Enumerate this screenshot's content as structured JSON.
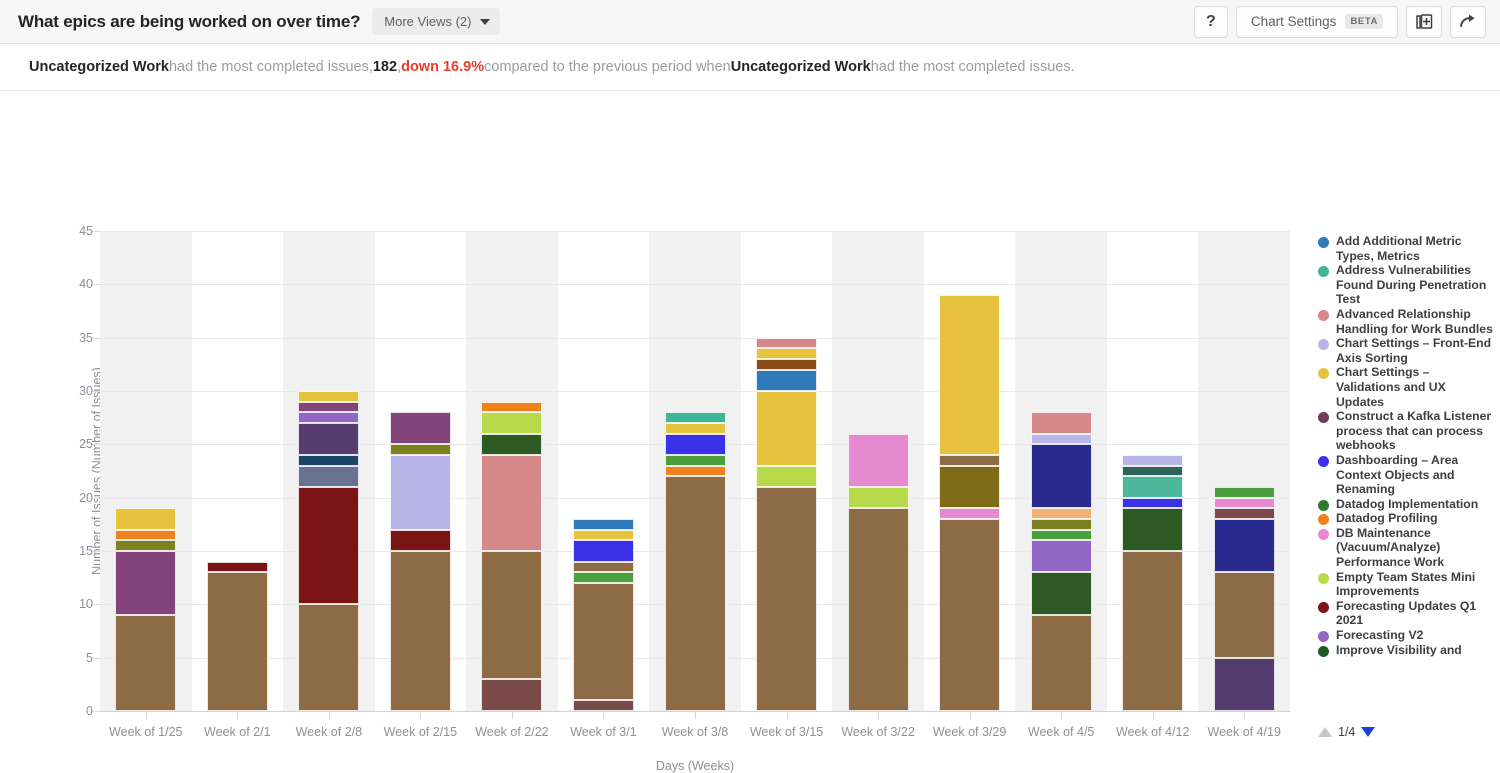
{
  "header": {
    "title": "What epics are being worked on over time?",
    "more_views_label": "More Views (2)",
    "help_label": "?",
    "chart_settings_label": "Chart Settings",
    "beta_label": "BETA",
    "duplicate_icon": "add-to-collection-icon",
    "share_icon": "share-arrow-icon"
  },
  "insight": {
    "entity": "Uncategorized Work",
    "text1": " had the most completed issues, ",
    "count": "182",
    "comma": ", ",
    "delta": "down 16.9%",
    "text2": " compared to the previous period when ",
    "entity2": "Uncategorized Work",
    "text3": " had the most completed issues."
  },
  "legend": {
    "page": "1/4",
    "items": [
      {
        "label": "Add Additional Metric Types, Metrics",
        "color": "#2f7ab8"
      },
      {
        "label": "Address Vulnerabilities Found During Penetration Test",
        "color": "#3fb597"
      },
      {
        "label": "Advanced Relationship Handling for Work Bundles",
        "color": "#d4888a"
      },
      {
        "label": "Chart Settings – Front-End Axis Sorting",
        "color": "#b9b5e8"
      },
      {
        "label": "Chart Settings – Validations and UX Updates",
        "color": "#e6c23f"
      },
      {
        "label": "Construct a Kafka Listener process that can process webhooks",
        "color": "#713a5e"
      },
      {
        "label": "Dashboarding – Area Context Objects and Renaming",
        "color": "#3b32e8"
      },
      {
        "label": "Datadog Implementation",
        "color": "#2d7a2a"
      },
      {
        "label": "Datadog Profiling",
        "color": "#f0821e"
      },
      {
        "label": "DB Maintenance (Vacuum/Analyze) Performance Work",
        "color": "#e589d0"
      },
      {
        "label": "Empty Team States Mini Improvements",
        "color": "#b7d94a"
      },
      {
        "label": "Forecasting Updates Q1 2021",
        "color": "#7b1414"
      },
      {
        "label": "Forecasting V2",
        "color": "#9166c4"
      },
      {
        "label": "Improve Visibility and",
        "color": "#1f5a22"
      }
    ]
  },
  "chart_data": {
    "type": "bar",
    "stacked": true,
    "title": "What epics are being worked on over time?",
    "xlabel": "Days (Weeks)",
    "ylabel": "Number of Issues (Number of Issues)",
    "ylim": [
      0,
      45
    ],
    "yticks": [
      0,
      5,
      10,
      15,
      20,
      25,
      30,
      35,
      40,
      45
    ],
    "grid": true,
    "legend_position": "right",
    "categories": [
      "Week of 1/25",
      "Week of 2/1",
      "Week of 2/8",
      "Week of 2/15",
      "Week of 2/22",
      "Week of 3/1",
      "Week of 3/8",
      "Week of 3/15",
      "Week of 3/22",
      "Week of 3/29",
      "Week of 4/5",
      "Week of 4/12",
      "Week of 4/19"
    ],
    "totals": [
      19,
      14,
      30,
      28,
      29,
      18,
      28,
      35,
      26,
      39,
      28,
      24,
      21
    ],
    "bars": [
      {
        "category": "Week of 1/25",
        "total": 19,
        "segments": [
          {
            "value": 9,
            "color": "#8d6b44"
          },
          {
            "value": 6,
            "color": "#82447a"
          },
          {
            "value": 1,
            "color": "#7d8021"
          },
          {
            "value": 1,
            "color": "#f0821e"
          },
          {
            "value": 2,
            "color": "#e6c23f"
          }
        ]
      },
      {
        "category": "Week of 2/1",
        "total": 14,
        "segments": [
          {
            "value": 13,
            "color": "#8d6b44"
          },
          {
            "value": 1,
            "color": "#7b1414"
          }
        ]
      },
      {
        "category": "Week of 2/8",
        "total": 30,
        "segments": [
          {
            "value": 10,
            "color": "#8d6b44"
          },
          {
            "value": 11,
            "color": "#7b1414"
          },
          {
            "value": 2,
            "color": "#6b7191"
          },
          {
            "value": 1,
            "color": "#1c4467"
          },
          {
            "value": 3,
            "color": "#553b6e"
          },
          {
            "value": 1,
            "color": "#9166c4"
          },
          {
            "value": 1,
            "color": "#82447a"
          },
          {
            "value": 1,
            "color": "#e6c23f"
          }
        ]
      },
      {
        "category": "Week of 2/15",
        "total": 28,
        "segments": [
          {
            "value": 15,
            "color": "#8d6b44"
          },
          {
            "value": 2,
            "color": "#7b1414"
          },
          {
            "value": 7,
            "color": "#b9b5e8"
          },
          {
            "value": 1,
            "color": "#7d8021"
          },
          {
            "value": 3,
            "color": "#82447a"
          }
        ]
      },
      {
        "category": "Week of 2/22",
        "total": 29,
        "segments": [
          {
            "value": 3,
            "color": "#7a4a4a"
          },
          {
            "value": 12,
            "color": "#8d6b44"
          },
          {
            "value": 9,
            "color": "#d4888a"
          },
          {
            "value": 2,
            "color": "#2d5a22"
          },
          {
            "value": 2,
            "color": "#b7d94a"
          },
          {
            "value": 1,
            "color": "#f0821e"
          }
        ]
      },
      {
        "category": "Week of 3/1",
        "total": 18,
        "segments": [
          {
            "value": 1,
            "color": "#7a4a4a"
          },
          {
            "value": 11,
            "color": "#8d6b44"
          },
          {
            "value": 1,
            "color": "#4a9e3c"
          },
          {
            "value": 1,
            "color": "#8d6b44"
          },
          {
            "value": 2,
            "color": "#3b32e8"
          },
          {
            "value": 1,
            "color": "#e6c23f"
          },
          {
            "value": 1,
            "color": "#2f7ab8"
          }
        ]
      },
      {
        "category": "Week of 3/8",
        "total": 28,
        "segments": [
          {
            "value": 22,
            "color": "#8d6b44"
          },
          {
            "value": 1,
            "color": "#f0821e"
          },
          {
            "value": 1,
            "color": "#4a9e3c"
          },
          {
            "value": 2,
            "color": "#3b32e8"
          },
          {
            "value": 1,
            "color": "#e6c23f"
          },
          {
            "value": 1,
            "color": "#3fb597"
          }
        ]
      },
      {
        "category": "Week of 3/15",
        "total": 35,
        "segments": [
          {
            "value": 21,
            "color": "#8d6b44"
          },
          {
            "value": 2,
            "color": "#b7d94a"
          },
          {
            "value": 7,
            "color": "#e6c23f"
          },
          {
            "value": 2,
            "color": "#2f7ab8"
          },
          {
            "value": 1,
            "color": "#8c4a14"
          },
          {
            "value": 1,
            "color": "#e6c23f"
          },
          {
            "value": 1,
            "color": "#d4888a"
          }
        ]
      },
      {
        "category": "Week of 3/22",
        "total": 26,
        "segments": [
          {
            "value": 19,
            "color": "#8d6b44"
          },
          {
            "value": 2,
            "color": "#b7d94a"
          },
          {
            "value": 5,
            "color": "#e589d0"
          }
        ]
      },
      {
        "category": "Week of 3/29",
        "total": 39,
        "segments": [
          {
            "value": 18,
            "color": "#8d6b44"
          },
          {
            "value": 1,
            "color": "#e589d0"
          },
          {
            "value": 4,
            "color": "#7d6b16"
          },
          {
            "value": 1,
            "color": "#8d6b44"
          },
          {
            "value": 15,
            "color": "#e6c23f"
          }
        ]
      },
      {
        "category": "Week of 4/5",
        "total": 28,
        "segments": [
          {
            "value": 9,
            "color": "#8d6b44"
          },
          {
            "value": 4,
            "color": "#2d5a22"
          },
          {
            "value": 3,
            "color": "#9166c4"
          },
          {
            "value": 1,
            "color": "#4a9e3c"
          },
          {
            "value": 1,
            "color": "#7d8021"
          },
          {
            "value": 1,
            "color": "#efb173"
          },
          {
            "value": 6,
            "color": "#282a8e"
          },
          {
            "value": 1,
            "color": "#b9b5e8"
          },
          {
            "value": 2,
            "color": "#d4888a"
          }
        ]
      },
      {
        "category": "Week of 4/12",
        "total": 24,
        "segments": [
          {
            "value": 15,
            "color": "#8d6b44"
          },
          {
            "value": 4,
            "color": "#2d5a22"
          },
          {
            "value": 1,
            "color": "#3b32e8"
          },
          {
            "value": 2,
            "color": "#4eb79b"
          },
          {
            "value": 1,
            "color": "#2c6558"
          },
          {
            "value": 1,
            "color": "#b9b5e8"
          }
        ]
      },
      {
        "category": "Week of 4/19",
        "total": 21,
        "segments": [
          {
            "value": 5,
            "color": "#553b6e"
          },
          {
            "value": 8,
            "color": "#8d6b44"
          },
          {
            "value": 5,
            "color": "#282a8e"
          },
          {
            "value": 1,
            "color": "#7a4a4a"
          },
          {
            "value": 1,
            "color": "#e589d0"
          },
          {
            "value": 1,
            "color": "#4a9e3c"
          }
        ]
      }
    ]
  }
}
